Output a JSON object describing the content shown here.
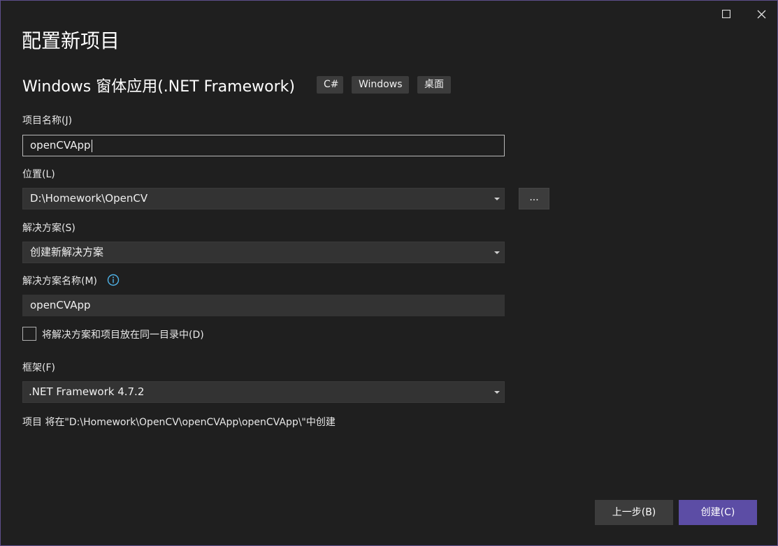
{
  "dialog": {
    "title": "配置新项目",
    "template_name": "Windows 窗体应用(.NET Framework)",
    "tags": [
      "C#",
      "Windows",
      "桌面"
    ]
  },
  "project_name": {
    "label": "项目名称(J)",
    "value": "openCVApp"
  },
  "location": {
    "label": "位置(L)",
    "value": "D:\\Homework\\OpenCV",
    "browse_label": "..."
  },
  "solution": {
    "label": "解决方案(S)",
    "value": "创建新解决方案"
  },
  "solution_name": {
    "label": "解决方案名称(M)",
    "value": "openCVApp"
  },
  "same_directory": {
    "label": "将解决方案和项目放在同一目录中(D)",
    "checked": false
  },
  "framework": {
    "label": "框架(F)",
    "value": ".NET Framework 4.7.2"
  },
  "summary": "项目 将在\"D:\\Homework\\OpenCV\\openCVApp\\openCVApp\\\"中创建",
  "buttons": {
    "back": "上一步(B)",
    "create": "创建(C)"
  },
  "colors": {
    "accent": "#5c4da5",
    "background": "#1f1f1f",
    "info_icon": "#4fb3e8"
  },
  "icons": {
    "maximize": "maximize-icon",
    "close": "close-icon",
    "info": "info-icon",
    "dropdown": "chevron-down-icon"
  }
}
